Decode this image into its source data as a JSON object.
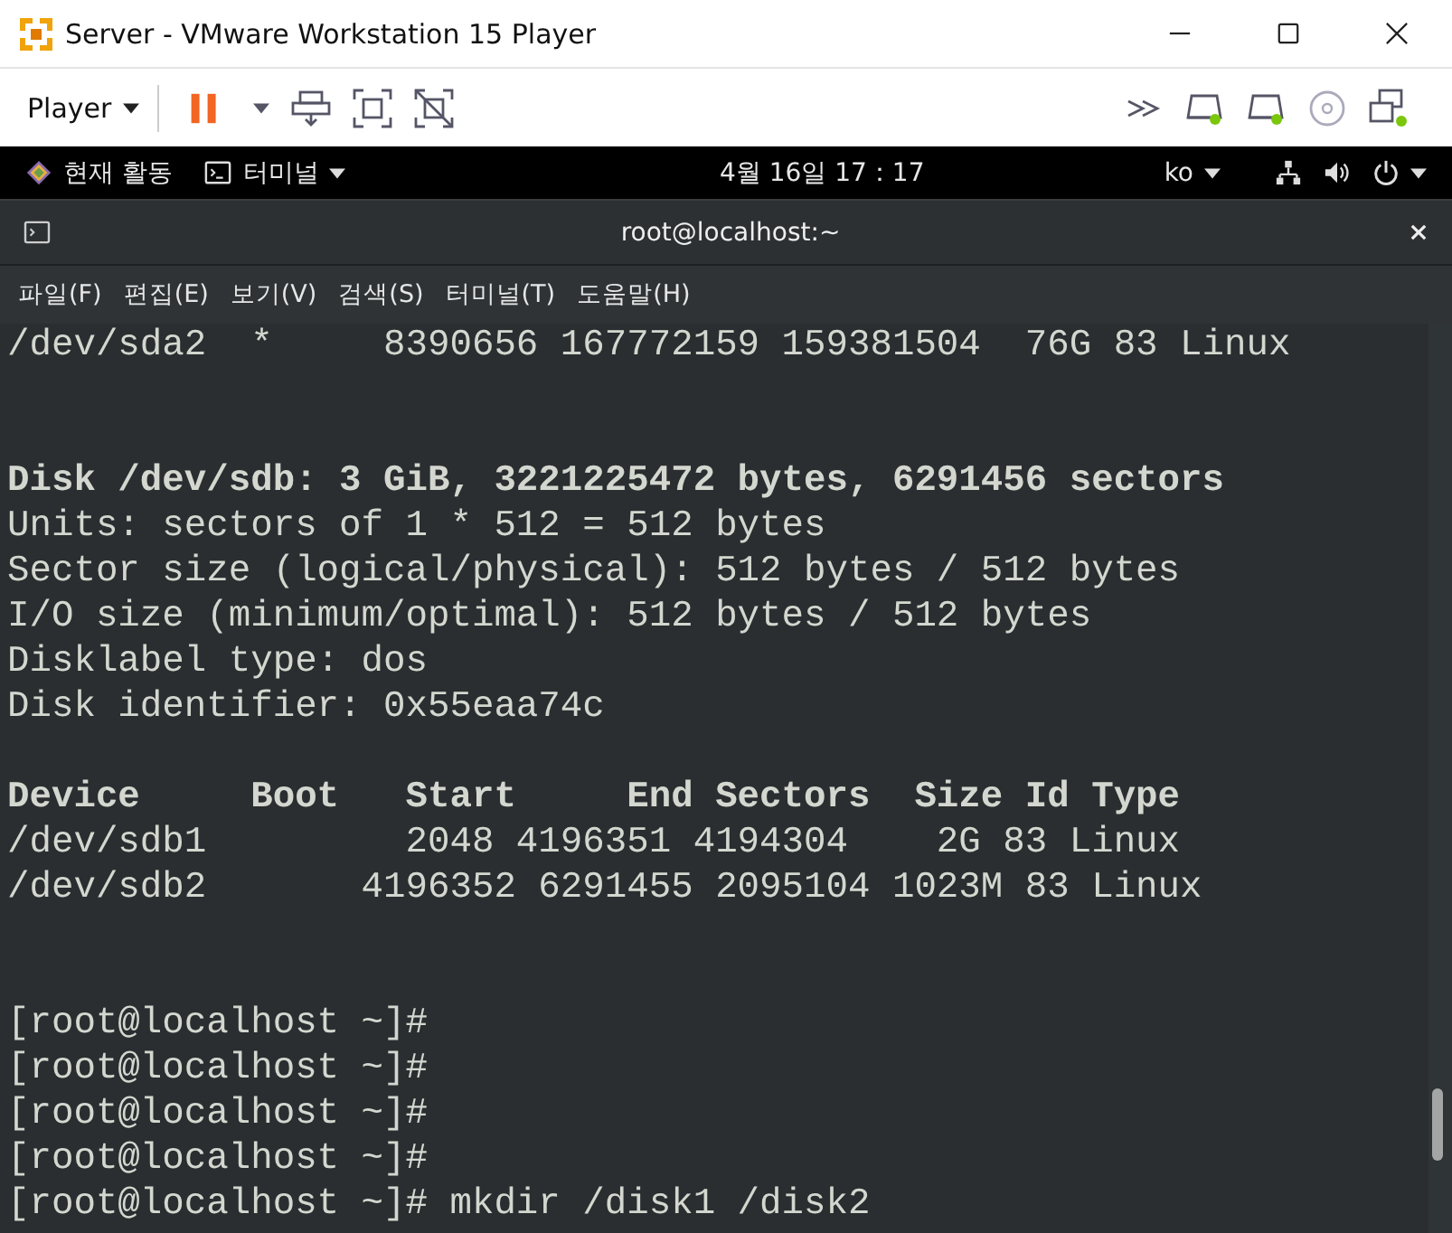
{
  "window": {
    "title": "Server - VMware Workstation 15 Player"
  },
  "toolbar": {
    "menu": "Player"
  },
  "top_bar": {
    "activities": "현재 활동",
    "app_menu": "터미널",
    "clock": "4월 16일 17：17",
    "input_method": "ko"
  },
  "terminal": {
    "title": "root@localhost:~",
    "menu": [
      "파일(F)",
      "편집(E)",
      "보기(V)",
      "검색(S)",
      "터미널(T)",
      "도움말(H)"
    ],
    "lines": [
      {
        "kind": "text",
        "text": "/dev/sda2  *     8390656 167772159 159381504  76G 83 Linux"
      },
      {
        "kind": "blank"
      },
      {
        "kind": "blank"
      },
      {
        "kind": "bold",
        "text": "Disk /dev/sdb: 3 GiB, 3221225472 bytes, 6291456 sectors"
      },
      {
        "kind": "text",
        "text": "Units: sectors of 1 * 512 = 512 bytes"
      },
      {
        "kind": "text",
        "text": "Sector size (logical/physical): 512 bytes / 512 bytes"
      },
      {
        "kind": "text",
        "text": "I/O size (minimum/optimal): 512 bytes / 512 bytes"
      },
      {
        "kind": "text",
        "text": "Disklabel type: dos"
      },
      {
        "kind": "text",
        "text": "Disk identifier: 0x55eaa74c"
      },
      {
        "kind": "blank"
      },
      {
        "kind": "bold",
        "text": "Device     Boot   Start     End Sectors  Size Id Type"
      },
      {
        "kind": "text",
        "text": "/dev/sdb1         2048 4196351 4194304    2G 83 Linux"
      },
      {
        "kind": "text",
        "text": "/dev/sdb2       4196352 6291455 2095104 1023M 83 Linux"
      },
      {
        "kind": "blank"
      },
      {
        "kind": "blank"
      },
      {
        "kind": "text",
        "text": "[root@localhost ~]#"
      },
      {
        "kind": "text",
        "text": "[root@localhost ~]#"
      },
      {
        "kind": "text",
        "text": "[root@localhost ~]#"
      },
      {
        "kind": "text",
        "text": "[root@localhost ~]#"
      },
      {
        "kind": "text",
        "text": "[root@localhost ~]# mkdir /disk1 /disk2"
      }
    ]
  }
}
